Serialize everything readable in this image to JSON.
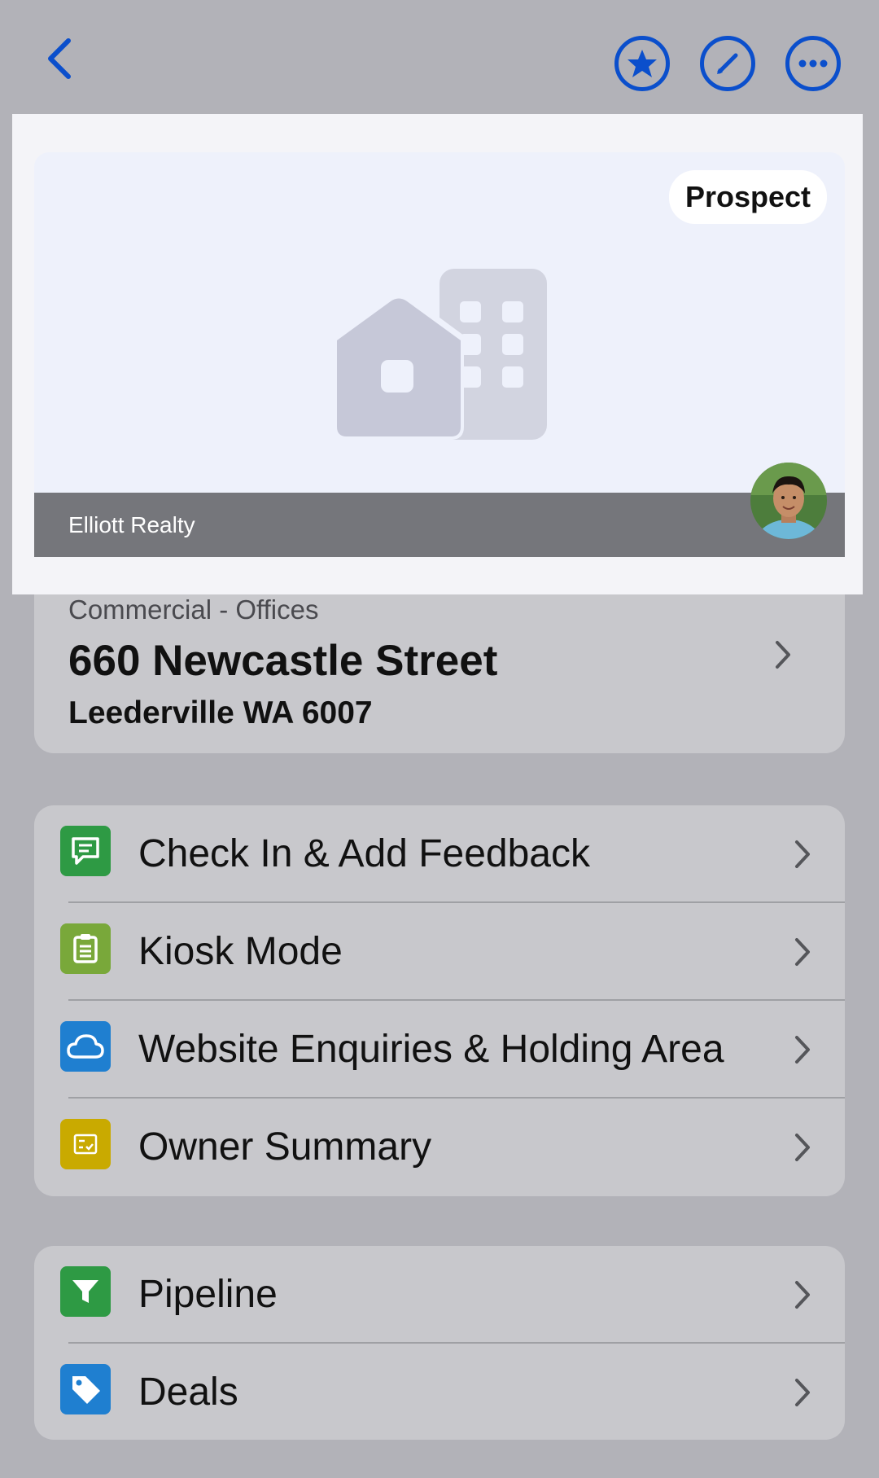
{
  "header": {
    "back_icon": "chevron-left-icon",
    "actions": [
      {
        "name": "favorite",
        "icon": "star-circle-icon"
      },
      {
        "name": "edit",
        "icon": "pencil-circle-icon"
      },
      {
        "name": "more",
        "icon": "ellipsis-circle-icon"
      }
    ],
    "accent_color": "#0b4fcc"
  },
  "listing": {
    "status_badge": "Prospect",
    "agency": "Elliott Realty",
    "category": "Commercial - Offices",
    "street": "660 Newcastle Street",
    "suburb": "Leederville WA 6007"
  },
  "actions_group_1": [
    {
      "label": "Check In & Add Feedback",
      "icon": "chat-feedback-icon",
      "color": "#2e9a44"
    },
    {
      "label": "Kiosk Mode",
      "icon": "clipboard-icon",
      "color": "#79a83a"
    },
    {
      "label": "Website Enquiries & Holding Area",
      "icon": "cloud-icon",
      "color": "#1f7fd0"
    },
    {
      "label": "Owner Summary",
      "icon": "checklist-icon",
      "color": "#c9aa00"
    }
  ],
  "actions_group_2": [
    {
      "label": "Pipeline",
      "icon": "funnel-icon",
      "color": "#2e9a44"
    },
    {
      "label": "Deals",
      "icon": "tag-icon",
      "color": "#1f7fd0"
    }
  ]
}
